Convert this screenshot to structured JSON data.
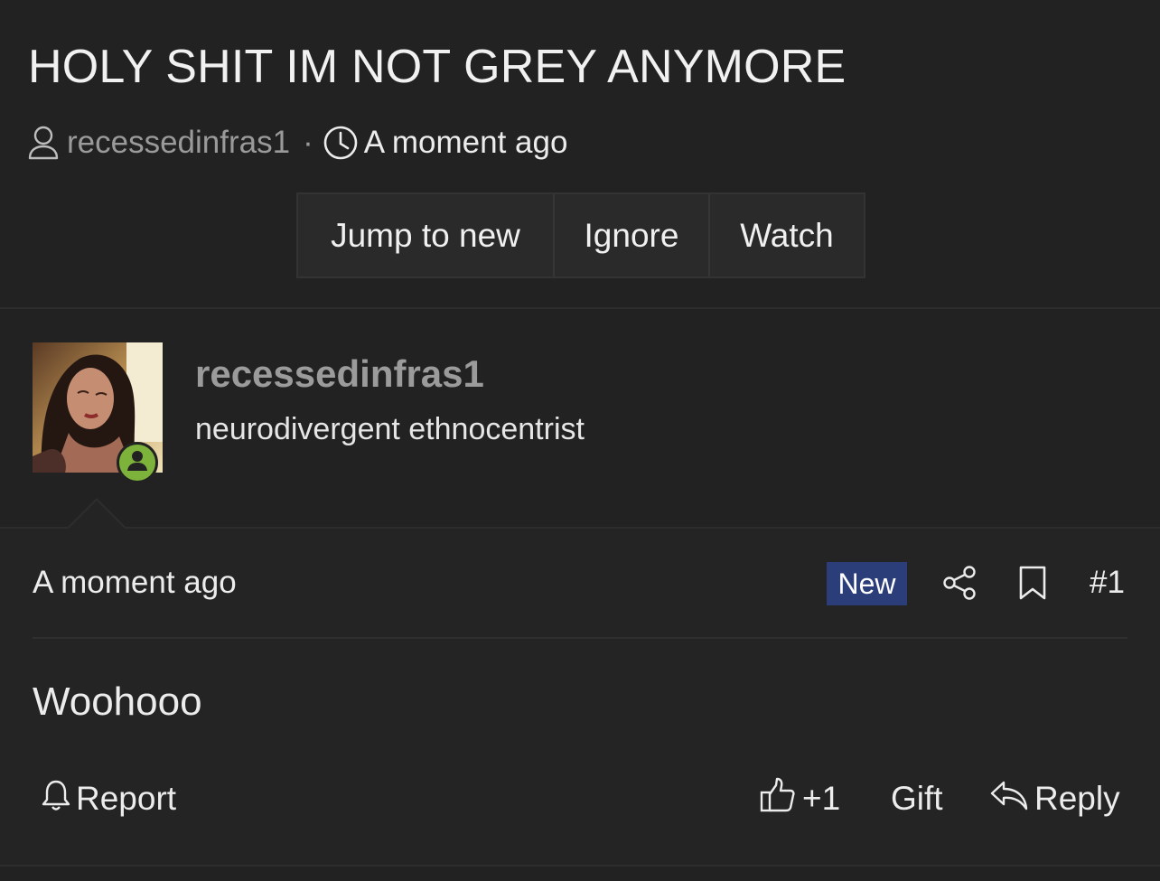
{
  "thread": {
    "title": "HOLY SHIT IM NOT GREY ANYMORE",
    "author": "recessedinfras1",
    "separator": "·",
    "time": "A moment ago",
    "actions": {
      "jump_label": "Jump to new",
      "ignore_label": "Ignore",
      "watch_label": "Watch"
    }
  },
  "post": {
    "user": {
      "name": "recessedinfras1",
      "title": "neurodivergent ethnocentrist",
      "status": "online"
    },
    "date": "A moment ago",
    "badge": "New",
    "number": "#1",
    "body": "Woohooo",
    "footer": {
      "report_label": "Report",
      "like_label": "+1",
      "gift_label": "Gift",
      "reply_label": "Reply"
    }
  },
  "colors": {
    "background": "#222222",
    "new_badge": "#2c3e7a",
    "online": "#7db33a",
    "muted_text": "#9b9b9b"
  },
  "icons": [
    "user-icon",
    "clock-icon",
    "share-icon",
    "bookmark-icon",
    "bell-icon",
    "thumbs-up-icon",
    "reply-icon",
    "online-user-icon"
  ]
}
